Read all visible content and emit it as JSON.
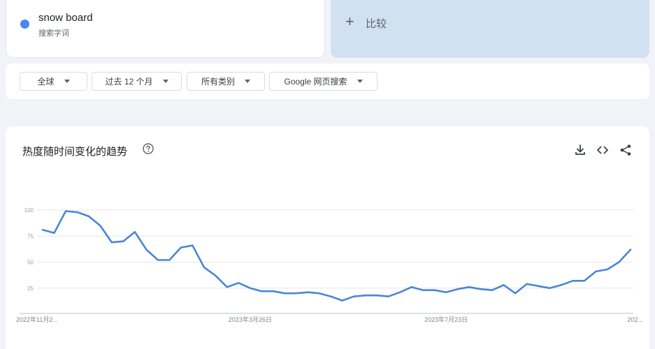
{
  "term": {
    "name": "snow board",
    "subtitle": "搜索字词",
    "color": "#4f86ec"
  },
  "compare": {
    "plus": "+",
    "label": "比较"
  },
  "filters": {
    "region": "全球",
    "time": "过去 12 个月",
    "category": "所有类别",
    "property": "Google 网页搜索"
  },
  "chart": {
    "title": "热度随时间变化的趋势",
    "icons": [
      "help-icon",
      "download-icon",
      "embed-icon",
      "share-icon"
    ]
  },
  "chart_data": {
    "type": "line",
    "ylim": [
      0,
      100
    ],
    "yticks": [
      25,
      50,
      75,
      100
    ],
    "grid": true,
    "line_color": "#4a86d4",
    "xlabels": [
      {
        "index": 0,
        "label": "2022年11月2..."
      },
      {
        "index": 18,
        "label": "2023年3月26日"
      },
      {
        "index": 35,
        "label": "2023年7月23日"
      },
      {
        "index": 51,
        "label": "202..."
      }
    ],
    "values": [
      81,
      78,
      99,
      98,
      94,
      85,
      69,
      70,
      79,
      62,
      52,
      52,
      64,
      66,
      45,
      37,
      26,
      30,
      25,
      22,
      22,
      20,
      20,
      21,
      20,
      17,
      13,
      17,
      18,
      18,
      17,
      21,
      26,
      23,
      23,
      21,
      24,
      26,
      24,
      23,
      28,
      20,
      29,
      27,
      25,
      28,
      32,
      32,
      41,
      43,
      50,
      62
    ]
  }
}
